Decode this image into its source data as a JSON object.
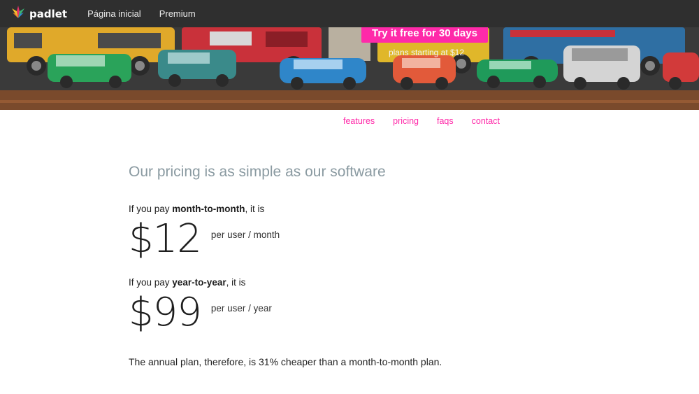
{
  "topbar": {
    "logo_text": "padlet",
    "nav": [
      "Página inicial",
      "Premium"
    ]
  },
  "hero": {
    "cta_label": "Try it free for 30 days",
    "plans_text": "plans starting at $12"
  },
  "subnav": {
    "features": "features",
    "pricing": "pricing",
    "faqs": "faqs",
    "contact": "contact"
  },
  "pricing": {
    "headline": "Our pricing is as simple as our software",
    "monthly_prefix": "If you pay ",
    "monthly_term": "month-to-month",
    "monthly_suffix": ", it is",
    "monthly_price": "$12",
    "monthly_unit": "per user / month",
    "yearly_prefix": "If you pay ",
    "yearly_term": "year-to-year",
    "yearly_suffix": ", it is",
    "yearly_price": "$99",
    "yearly_unit": "per user / year",
    "summary": "The annual plan, therefore, is 31% cheaper than a month-to-month plan."
  },
  "colors": {
    "accent": "#ff2aa9",
    "topbar_bg": "#2f2f2f",
    "headline": "#8a9aa1"
  },
  "icons": [
    "padlet-logo-icon"
  ]
}
